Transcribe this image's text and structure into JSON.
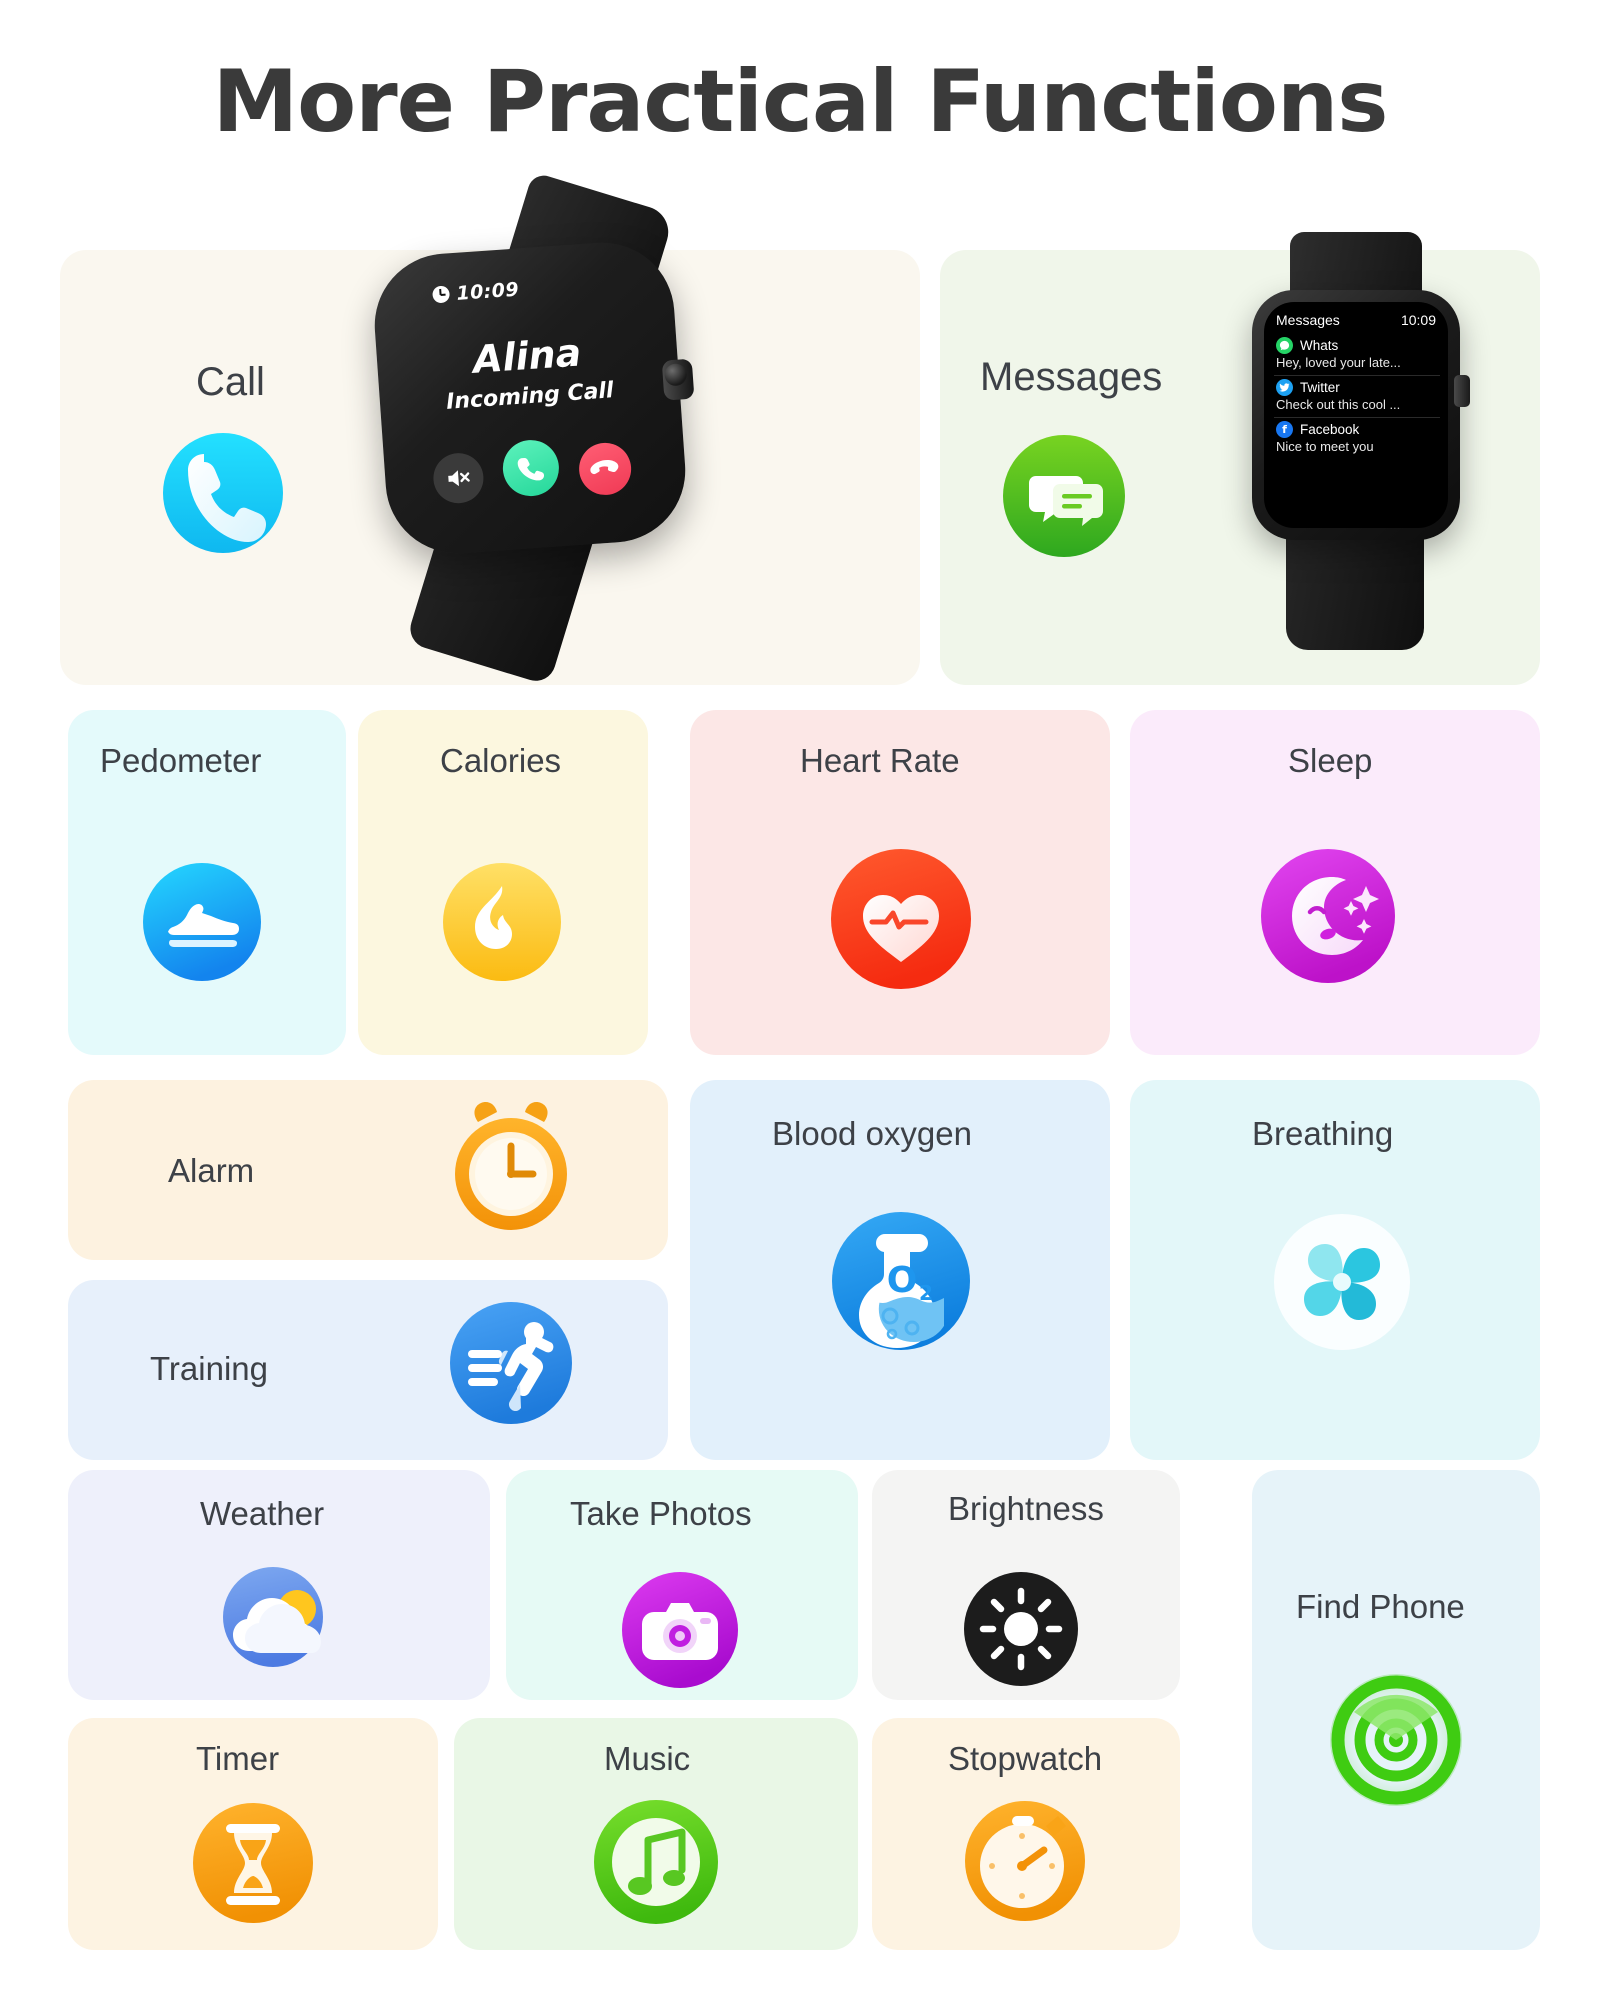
{
  "header": {
    "title": "More Practical Functions"
  },
  "cards": {
    "call": {
      "label": "Call",
      "bg": "#FAF7EF",
      "icon": "phone-icon",
      "watch": {
        "time": "10:09",
        "caller": "Alina",
        "status": "Incoming Call",
        "buttons": [
          "mute-button",
          "accept-call-button",
          "decline-call-button"
        ]
      }
    },
    "messages": {
      "label": "Messages",
      "bg": "#F0F6EA",
      "icon": "chat-bubble-icon",
      "watch": {
        "header_title": "Messages",
        "header_time": "10:09",
        "items": [
          {
            "app": "Whats",
            "icon": "whatsapp-icon",
            "color": "#25D366",
            "preview": "Hey, loved your late..."
          },
          {
            "app": "Twitter",
            "icon": "twitter-icon",
            "color": "#1DA1F2",
            "preview": "Check out this cool ..."
          },
          {
            "app": "Facebook",
            "icon": "facebook-icon",
            "color": "#1877F2",
            "preview": "Nice to meet you"
          }
        ]
      }
    },
    "pedometer": {
      "label": "Pedometer",
      "bg": "#E4FAFB",
      "icon": "shoe-icon",
      "accent": "#16A9F2"
    },
    "calories": {
      "label": "Calories",
      "bg": "#FCF7DF",
      "icon": "flame-icon",
      "accent": "#FFC928"
    },
    "heart_rate": {
      "label": "Heart Rate",
      "bg": "#FCE7E6",
      "icon": "heart-pulse-icon",
      "accent": "#FA3F1C"
    },
    "sleep": {
      "label": "Sleep",
      "bg": "#FBEBFB",
      "icon": "sleeping-moon-icon",
      "accent": "#D423D4"
    },
    "alarm": {
      "label": "Alarm",
      "bg": "#FDF2E0",
      "icon": "alarm-clock-icon",
      "accent": "#F9A215"
    },
    "training": {
      "label": "Training",
      "bg": "#E7F0FB",
      "icon": "runner-icon",
      "accent": "#2E8EE8"
    },
    "blood_oxygen": {
      "label": "Blood oxygen",
      "bg": "#E2F0FB",
      "icon": "oxygen-flask-icon",
      "accent": "#1E96EE"
    },
    "breathing": {
      "label": "Breathing",
      "bg": "#E3F7F9",
      "icon": "pinwheel-icon",
      "accent": "#23C3D6"
    },
    "weather": {
      "label": "Weather",
      "bg": "#EEF0FB",
      "icon": "sun-cloud-icon",
      "accent": "#5A8CE8"
    },
    "take_photos": {
      "label": "Take Photos",
      "bg": "#E6FAF5",
      "icon": "camera-icon",
      "accent": "#C51ED8"
    },
    "brightness": {
      "label": "Brightness",
      "bg": "#F4F4F3",
      "icon": "brightness-sun-icon",
      "accent": "#1C1C1C"
    },
    "find_phone": {
      "label": "Find Phone",
      "bg": "#E6F3F9",
      "icon": "radar-icon",
      "accent": "#3FCC12"
    },
    "timer": {
      "label": "Timer",
      "bg": "#FDF3E2",
      "icon": "hourglass-timer-icon",
      "accent": "#F6A316"
    },
    "music": {
      "label": "Music",
      "bg": "#E9F7E6",
      "icon": "music-note-icon",
      "accent": "#52CC1A"
    },
    "stopwatch": {
      "label": "Stopwatch",
      "bg": "#FDF3E2",
      "icon": "stopwatch-icon",
      "accent": "#F6A316"
    }
  }
}
